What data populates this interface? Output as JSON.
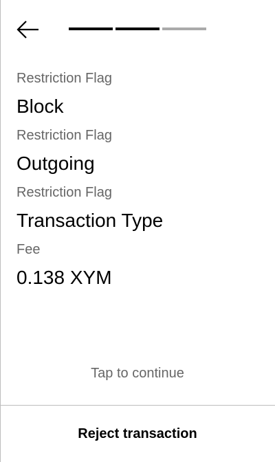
{
  "header": {
    "back_icon": "arrow-left-icon",
    "progress": {
      "total_steps": 3,
      "completed_steps": 2,
      "active_color": "#000000",
      "inactive_color": "#aaaaaa"
    }
  },
  "fields": [
    {
      "label": "Restriction Flag",
      "value": "Block"
    },
    {
      "label": "Restriction Flag",
      "value": "Outgoing"
    },
    {
      "label": "Restriction Flag",
      "value": "Transaction Type"
    },
    {
      "label": "Fee",
      "value": "0.138 XYM"
    }
  ],
  "tap_hint": "Tap to continue",
  "reject_label": "Reject transaction"
}
